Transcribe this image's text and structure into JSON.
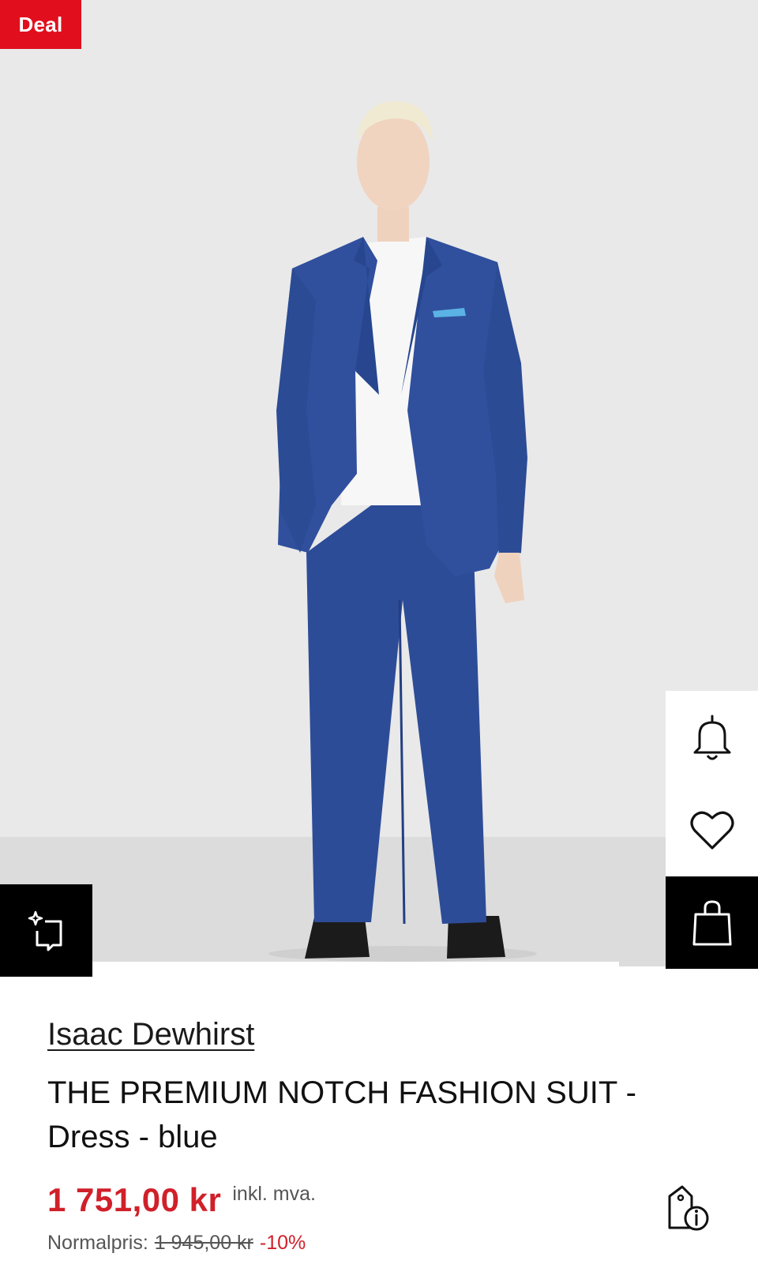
{
  "badge": {
    "label": "Deal"
  },
  "hero": {
    "image_alt": "Model wearing blue suit"
  },
  "actions": {
    "similar": "similar-items-icon",
    "notify": "bell-icon",
    "wishlist": "heart-icon",
    "cart": "shopping-bag-icon"
  },
  "product": {
    "brand": "Isaac Dewhirst",
    "title": "THE PREMIUM NOTCH FASHION SUIT - Dress - blue",
    "price": "1 751,00 kr",
    "vat_note": "inkl. mva.",
    "normal_label": "Normalpris:",
    "normal_price": "1 945,00 kr",
    "discount": "-10%"
  },
  "colors": {
    "accent_red": "#e10f1e",
    "price_red": "#d0202a",
    "suit_blue": "#2f4f9a"
  }
}
